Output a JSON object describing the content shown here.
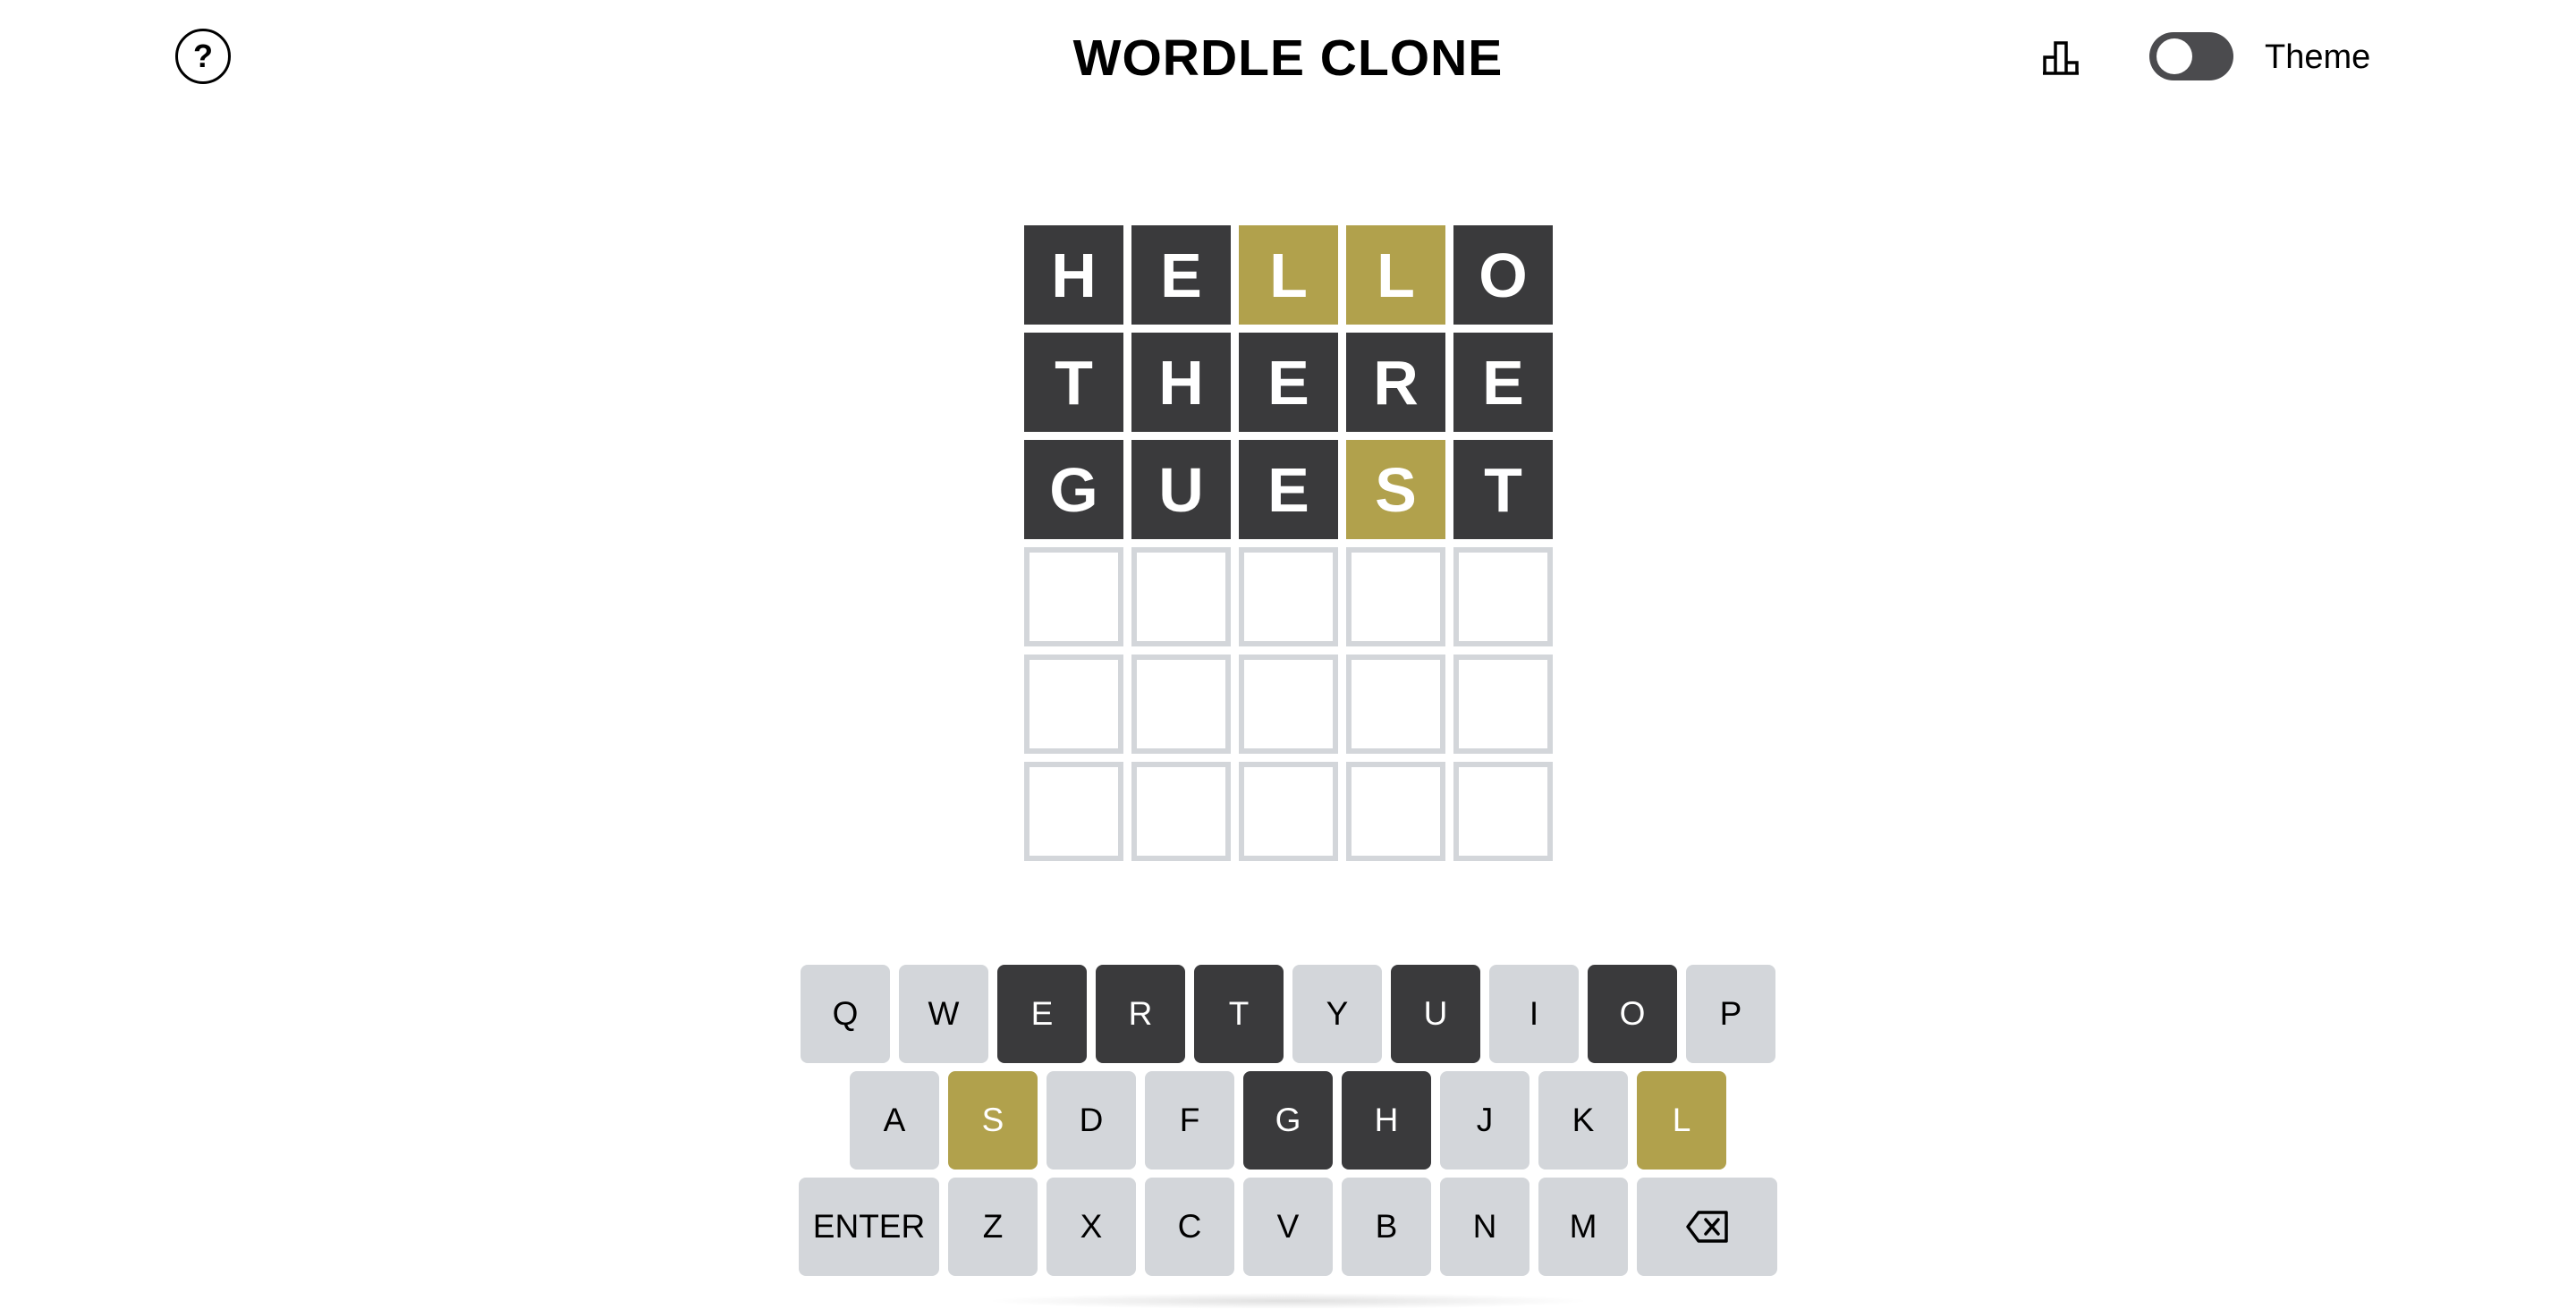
{
  "header": {
    "help_label": "?",
    "title": "WORDLE CLONE",
    "stats_icon": "bar-chart-icon",
    "theme_label": "Theme",
    "theme_toggle_on": false
  },
  "colors": {
    "absent": "#3a3a3c",
    "present": "#b1a14c",
    "empty_border": "#d3d6da",
    "key_default": "#d3d6da"
  },
  "grid": {
    "rows": [
      {
        "tiles": [
          {
            "letter": "H",
            "state": "absent"
          },
          {
            "letter": "E",
            "state": "absent"
          },
          {
            "letter": "L",
            "state": "present"
          },
          {
            "letter": "L",
            "state": "present"
          },
          {
            "letter": "O",
            "state": "absent"
          }
        ]
      },
      {
        "tiles": [
          {
            "letter": "T",
            "state": "absent"
          },
          {
            "letter": "H",
            "state": "absent"
          },
          {
            "letter": "E",
            "state": "absent"
          },
          {
            "letter": "R",
            "state": "absent"
          },
          {
            "letter": "E",
            "state": "absent"
          }
        ]
      },
      {
        "tiles": [
          {
            "letter": "G",
            "state": "absent"
          },
          {
            "letter": "U",
            "state": "absent"
          },
          {
            "letter": "E",
            "state": "absent"
          },
          {
            "letter": "S",
            "state": "present"
          },
          {
            "letter": "T",
            "state": "absent"
          }
        ]
      },
      {
        "tiles": [
          {
            "letter": "",
            "state": "empty"
          },
          {
            "letter": "",
            "state": "empty"
          },
          {
            "letter": "",
            "state": "empty"
          },
          {
            "letter": "",
            "state": "empty"
          },
          {
            "letter": "",
            "state": "empty"
          }
        ]
      },
      {
        "tiles": [
          {
            "letter": "",
            "state": "empty"
          },
          {
            "letter": "",
            "state": "empty"
          },
          {
            "letter": "",
            "state": "empty"
          },
          {
            "letter": "",
            "state": "empty"
          },
          {
            "letter": "",
            "state": "empty"
          }
        ]
      },
      {
        "tiles": [
          {
            "letter": "",
            "state": "empty"
          },
          {
            "letter": "",
            "state": "empty"
          },
          {
            "letter": "",
            "state": "empty"
          },
          {
            "letter": "",
            "state": "empty"
          },
          {
            "letter": "",
            "state": "empty"
          }
        ]
      }
    ]
  },
  "keyboard": {
    "rows": [
      [
        {
          "label": "Q",
          "state": "default"
        },
        {
          "label": "W",
          "state": "default"
        },
        {
          "label": "E",
          "state": "absent"
        },
        {
          "label": "R",
          "state": "absent"
        },
        {
          "label": "T",
          "state": "absent"
        },
        {
          "label": "Y",
          "state": "default"
        },
        {
          "label": "U",
          "state": "absent"
        },
        {
          "label": "I",
          "state": "default"
        },
        {
          "label": "O",
          "state": "absent"
        },
        {
          "label": "P",
          "state": "default"
        }
      ],
      [
        {
          "label": "A",
          "state": "default"
        },
        {
          "label": "S",
          "state": "present"
        },
        {
          "label": "D",
          "state": "default"
        },
        {
          "label": "F",
          "state": "default"
        },
        {
          "label": "G",
          "state": "absent"
        },
        {
          "label": "H",
          "state": "absent"
        },
        {
          "label": "J",
          "state": "default"
        },
        {
          "label": "K",
          "state": "default"
        },
        {
          "label": "L",
          "state": "present"
        }
      ],
      [
        {
          "label": "ENTER",
          "state": "default",
          "wide": true
        },
        {
          "label": "Z",
          "state": "default"
        },
        {
          "label": "X",
          "state": "default"
        },
        {
          "label": "C",
          "state": "default"
        },
        {
          "label": "V",
          "state": "default"
        },
        {
          "label": "B",
          "state": "default"
        },
        {
          "label": "N",
          "state": "default"
        },
        {
          "label": "M",
          "state": "default"
        },
        {
          "label": "",
          "icon": "backspace-icon",
          "state": "default",
          "wide": true
        }
      ]
    ]
  }
}
